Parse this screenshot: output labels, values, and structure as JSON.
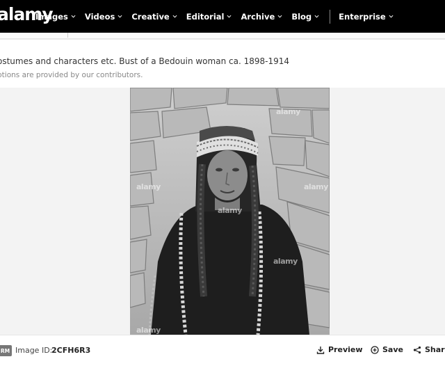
{
  "brand": {
    "logo_text": "alamy"
  },
  "nav": {
    "items": [
      {
        "label": "Images"
      },
      {
        "label": "Videos"
      },
      {
        "label": "Creative"
      },
      {
        "label": "Editorial"
      },
      {
        "label": "Archive"
      },
      {
        "label": "Blog"
      }
    ],
    "enterprise_label": "Enterprise"
  },
  "caption": {
    "title": "ostumes and characters etc. Bust of a Bedouin woman ca. 1898-1914",
    "note": "ptions are provided by our contributors."
  },
  "image": {
    "watermark": "alamy",
    "subject": "Black-and-white photograph of a Bedouin woman in headscarf and robe before a stone wall"
  },
  "footer": {
    "license_badge": "RM",
    "image_id_label": "Image ID:",
    "image_id_value": "2CFH6R3",
    "preview_label": "Preview",
    "save_label": "Save",
    "share_label": "Share"
  }
}
